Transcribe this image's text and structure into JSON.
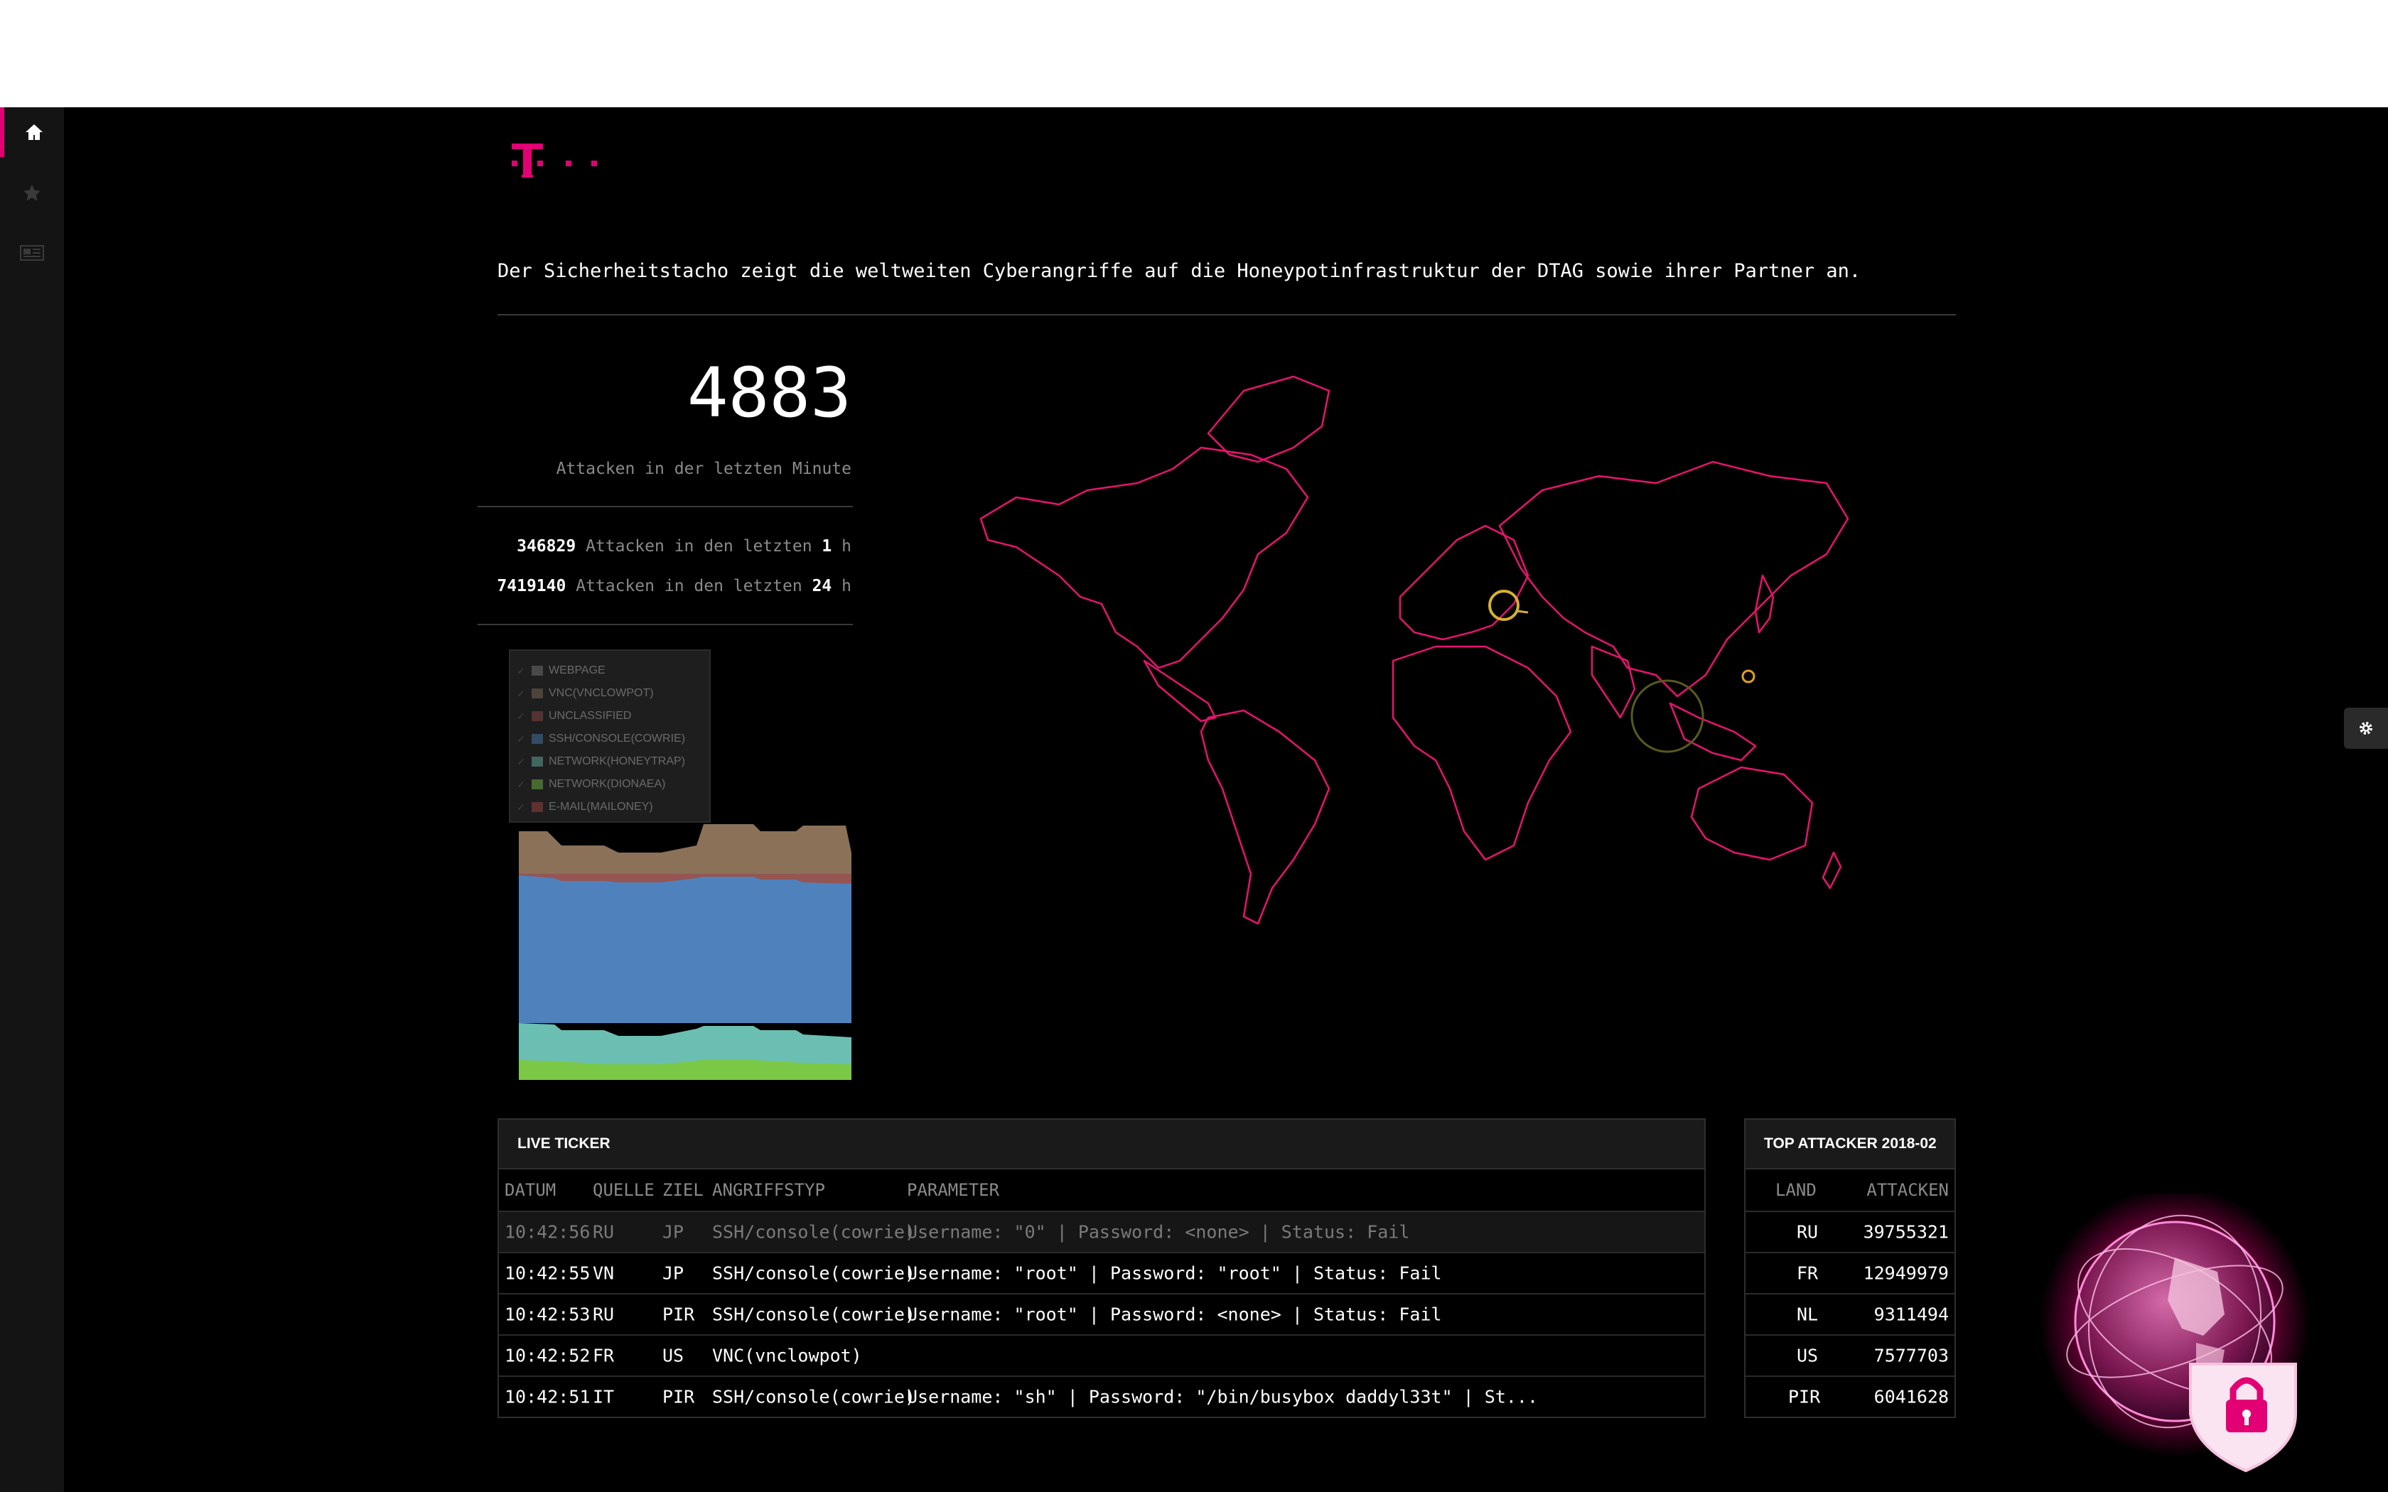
{
  "description": "Der Sicherheitstacho zeigt die weltweiten Cyberangriffe auf die Honeypotinfrastruktur der DTAG sowie ihrer Partner an.",
  "logo": {
    "letter": "T",
    "dots": "· ·"
  },
  "sidebar": {
    "items": [
      "home-icon",
      "star-icon",
      "newspaper-icon"
    ]
  },
  "attacks": {
    "last_minute_value": "4883",
    "last_minute_label": "Attacken in der letzten Minute",
    "stats": [
      {
        "value": "346829",
        "text": "Attacken in den letzten",
        "n": "1",
        "unit": "h"
      },
      {
        "value": "7419140",
        "text": "Attacken in den letzten",
        "n": "24",
        "unit": "h"
      }
    ]
  },
  "legend": [
    {
      "label": "WEBPAGE",
      "color": "#7f7f7f"
    },
    {
      "label": "VNC(VNCLOWPOT)",
      "color": "#8a7158"
    },
    {
      "label": "UNCLASSIFIED",
      "color": "#9a4a50"
    },
    {
      "label": "SSH/CONSOLE(COWRIE)",
      "color": "#4f82bd"
    },
    {
      "label": "NETWORK(HONEYTRAP)",
      "color": "#6bbfb2"
    },
    {
      "label": "NETWORK(DIONAEA)",
      "color": "#7bc846"
    },
    {
      "label": "E-MAIL(MAILONEY)",
      "color": "#b04848"
    }
  ],
  "ticker": {
    "title": "LIVE TICKER",
    "columns": [
      "DATUM",
      "QUELLE",
      "ZIEL",
      "ANGRIFFSTYP",
      "PARAMETER"
    ],
    "rows": [
      {
        "datum": "10:42:56",
        "quelle": "RU",
        "ziel": "JP",
        "typ": "SSH/console(cowrie)",
        "param": "Username: \"0\" | Password: <none> | Status: Fail"
      },
      {
        "datum": "10:42:55",
        "quelle": "VN",
        "ziel": "JP",
        "typ": "SSH/console(cowrie)",
        "param": "Username: \"root\" | Password: \"root\" | Status: Fail"
      },
      {
        "datum": "10:42:53",
        "quelle": "RU",
        "ziel": "PIR",
        "typ": "SSH/console(cowrie)",
        "param": "Username: \"root\" | Password: <none> | Status: Fail"
      },
      {
        "datum": "10:42:52",
        "quelle": "FR",
        "ziel": "US",
        "typ": "VNC(vnclowpot)",
        "param": ""
      },
      {
        "datum": "10:42:51",
        "quelle": "IT",
        "ziel": "PIR",
        "typ": "SSH/console(cowrie)",
        "param": "Username: \"sh\" | Password: \"/bin/busybox daddyl33t\" | St..."
      }
    ]
  },
  "top_attacker": {
    "title": "TOP ATTACKER 2018-02",
    "columns": [
      "LAND",
      "ATTACKEN"
    ],
    "rows": [
      {
        "land": "RU",
        "attacken": "39755321"
      },
      {
        "land": "FR",
        "attacken": "12949979"
      },
      {
        "land": "NL",
        "attacken": "9311494"
      },
      {
        "land": "US",
        "attacken": "7577703"
      },
      {
        "land": "PIR",
        "attacken": "6041628"
      }
    ]
  },
  "colors": {
    "magenta": "#e20074",
    "map_outline": "#e8136f",
    "marker": "#d6b032"
  }
}
